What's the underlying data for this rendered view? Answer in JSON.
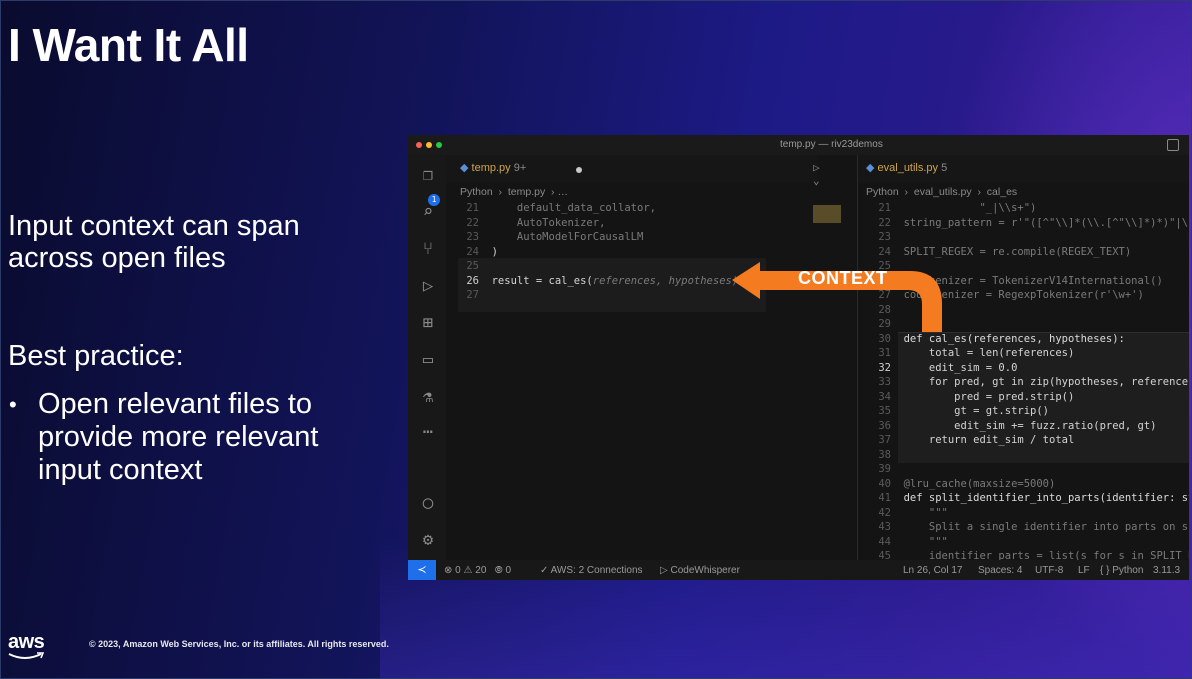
{
  "slide": {
    "title": "I Want It All",
    "intro_line1": "Input context can span",
    "intro_line2": "across open files",
    "practice_heading": "Best practice:",
    "bullet_marker": "•",
    "bullet_line1": "Open relevant files to",
    "bullet_line2": "provide more relevant",
    "bullet_line3": "input context",
    "callout": "CONTEXT",
    "copyright": "© 2023, Amazon Web Services, Inc. or its affiliates. All rights reserved.",
    "logo_text": "aws"
  },
  "editor": {
    "window_title": "temp.py — riv23demos",
    "activity_badge": "1",
    "left_tab": {
      "name": "temp.py",
      "modified": "9+"
    },
    "left_breadcrumb": "Python  ›  temp.py  › …",
    "left_lines": [
      {
        "n": "21",
        "text": "    default_data_collator,"
      },
      {
        "n": "22",
        "text": "    AutoTokenizer,"
      },
      {
        "n": "23",
        "text": "    AutoModelForCausalLM"
      },
      {
        "n": "24",
        "text": ")"
      },
      {
        "n": "25",
        "text": ""
      },
      {
        "n": "26",
        "text": "result = cal_es("
      },
      {
        "n": "27",
        "text": ""
      }
    ],
    "ghost_suggestion": "references, hypotheses)",
    "right_tab": {
      "name": "eval_utils.py",
      "modified": "5"
    },
    "right_breadcrumb": "Python  ›  eval_utils.py  ›  cal_es",
    "right_lines": [
      {
        "n": "21",
        "text": "            \"_|\\\\s+\")"
      },
      {
        "n": "22",
        "text": "string_pattern = r'\"([^\"\\\\]*(\\\\.[^\"\\\\]*)*)\"|\\'(['"
      },
      {
        "n": "23",
        "text": ""
      },
      {
        "n": "24",
        "text": "SPLIT_REGEX = re.compile(REGEX_TEXT)"
      },
      {
        "n": "25",
        "text": ""
      },
      {
        "n": "26",
        "text": "    kenizer = TokenizerV14International()"
      },
      {
        "n": "27",
        "text": "cod  kenizer = RegexpTokenizer(r'\\w+')"
      },
      {
        "n": "28",
        "text": ""
      },
      {
        "n": "29",
        "text": ""
      },
      {
        "n": "30",
        "text": "def cal_es(references, hypotheses):"
      },
      {
        "n": "31",
        "text": "    total = len(references)"
      },
      {
        "n": "32",
        "text": "    edit_sim = 0.0"
      },
      {
        "n": "33",
        "text": "    for pred, gt in zip(hypotheses, references):"
      },
      {
        "n": "34",
        "text": "        pred = pred.strip()"
      },
      {
        "n": "35",
        "text": "        gt = gt.strip()"
      },
      {
        "n": "36",
        "text": "        edit_sim += fuzz.ratio(pred, gt)"
      },
      {
        "n": "37",
        "text": "    return edit_sim / total"
      },
      {
        "n": "38",
        "text": ""
      },
      {
        "n": "39",
        "text": ""
      },
      {
        "n": "40",
        "text": "@lru_cache(maxsize=5000)"
      },
      {
        "n": "41",
        "text": "def split_identifier_into_parts(identifier: str) —"
      },
      {
        "n": "42",
        "text": "    \"\"\""
      },
      {
        "n": "43",
        "text": "    Split a single identifier into parts on snake"
      },
      {
        "n": "44",
        "text": "    \"\"\""
      },
      {
        "n": "45",
        "text": "    identifier_parts = list(s for s in SPLIT_REGE"
      }
    ],
    "status": {
      "errors": "0",
      "warnings": "20",
      "info": "0",
      "aws": "AWS: 2 Connections",
      "codewhisperer": "CodeWhisperer",
      "position": "Ln 26, Col 17",
      "spaces": "Spaces: 4",
      "encoding": "UTF-8",
      "eol": "LF",
      "language": "Python",
      "version": "3.11.3"
    }
  },
  "colors": {
    "arrow": "#f47b20",
    "accent": "#1f6feb"
  }
}
